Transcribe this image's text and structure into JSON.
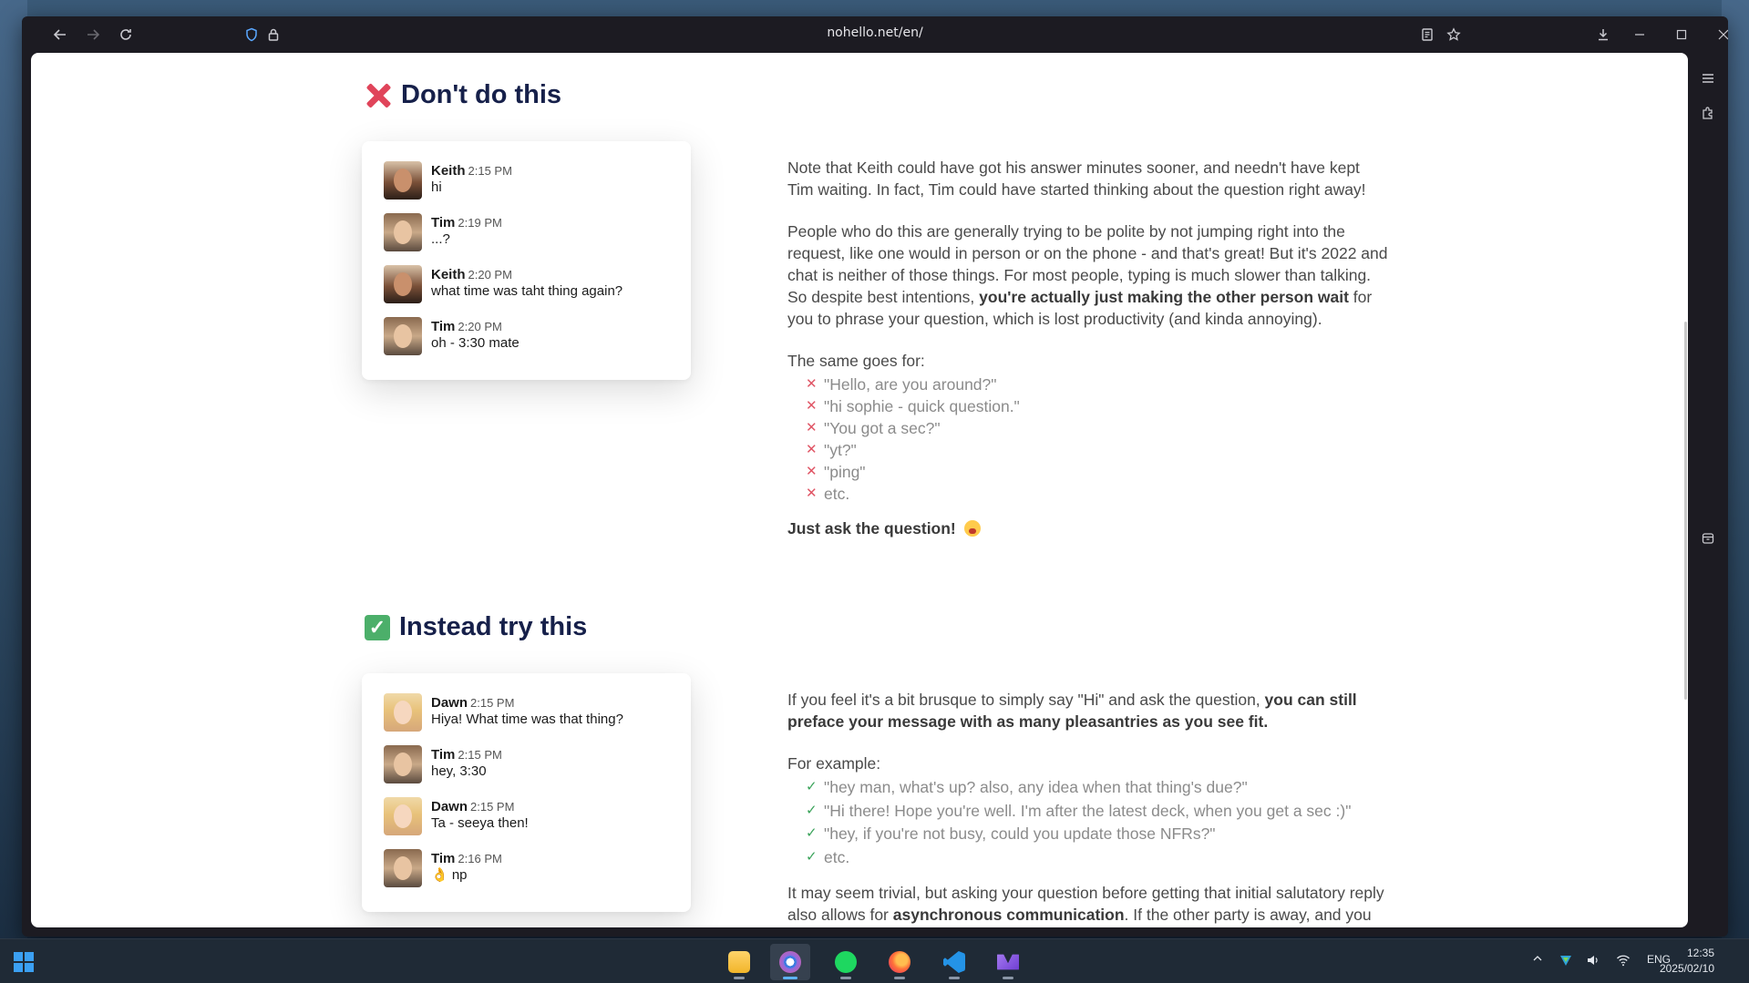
{
  "browser": {
    "url": "nohello.net/en/"
  },
  "section_dont": {
    "title": "Don't do this",
    "messages": [
      {
        "author": "Keith",
        "time": "2:15 PM",
        "text": "hi",
        "avatar": "keith"
      },
      {
        "author": "Tim",
        "time": "2:19 PM",
        "text": "...?",
        "avatar": "tim"
      },
      {
        "author": "Keith",
        "time": "2:20 PM",
        "text": "what time was taht thing again?",
        "avatar": "keith"
      },
      {
        "author": "Tim",
        "time": "2:20 PM",
        "text": "oh - 3:30 mate",
        "avatar": "tim"
      }
    ],
    "para1": "Note that Keith could have got his answer minutes sooner, and needn't have kept Tim waiting. In fact, Tim could have started thinking about the question right away!",
    "para2_pre": "People who do this are generally trying to be polite by not jumping right into the request, like one would in person or on the phone - and that's great! But it's 2022 and chat is neither of those things. For most people, typing is much slower than talking. So despite best intentions, ",
    "para2_bold": "you're actually just making the other person wait",
    "para2_post": " for you to phrase your question, which is lost productivity (and kinda annoying).",
    "same_goes": "The same goes for:",
    "bad_examples": [
      "\"Hello, are you around?\"",
      "\"hi sophie - quick question.\"",
      "\"You got a sec?\"",
      "\"yt?\"",
      "\"ping\"",
      "etc."
    ],
    "just_ask": "Just ask the question!"
  },
  "section_try": {
    "title": "Instead try this",
    "messages": [
      {
        "author": "Dawn",
        "time": "2:15 PM",
        "text": "Hiya! What time was that thing?",
        "avatar": "dawn"
      },
      {
        "author": "Tim",
        "time": "2:15 PM",
        "text": "hey, 3:30",
        "avatar": "tim"
      },
      {
        "author": "Dawn",
        "time": "2:15 PM",
        "text": "Ta - seeya then!",
        "avatar": "dawn"
      },
      {
        "author": "Tim",
        "time": "2:16 PM",
        "text": "👌 np",
        "avatar": "tim"
      }
    ],
    "para1_pre": "If you feel it's a bit brusque to simply say \"Hi\" and ask the question, ",
    "para1_bold": "you can still preface your message with as many pleasantries as you see fit.",
    "for_example": "For example:",
    "good_examples": [
      "\"hey man, what's up? also, any idea when that thing's due?\"",
      "\"Hi there! Hope you're well. I'm after the latest deck, when you get a sec :)\"",
      "\"hey, if you're not busy, could you update those NFRs?\"",
      "etc."
    ],
    "para2_pre": "It may seem trivial, but asking your question before getting that initial salutatory reply also allows for ",
    "para2_bold": "asynchronous communication",
    "para2_post": ". If the other party is away, and you leave before they come back, they can still answer your question, instead of"
  },
  "taskbar": {
    "apps": [
      "file-explorer",
      "chrome",
      "spotify",
      "firefox",
      "vscode",
      "obsidian"
    ],
    "lang": "ENG",
    "time": "12:35",
    "date": "2025/02/10"
  },
  "colors": {
    "heading": "#16204a",
    "bad_mark": "#e05565",
    "good_mark": "#3aa35a"
  }
}
